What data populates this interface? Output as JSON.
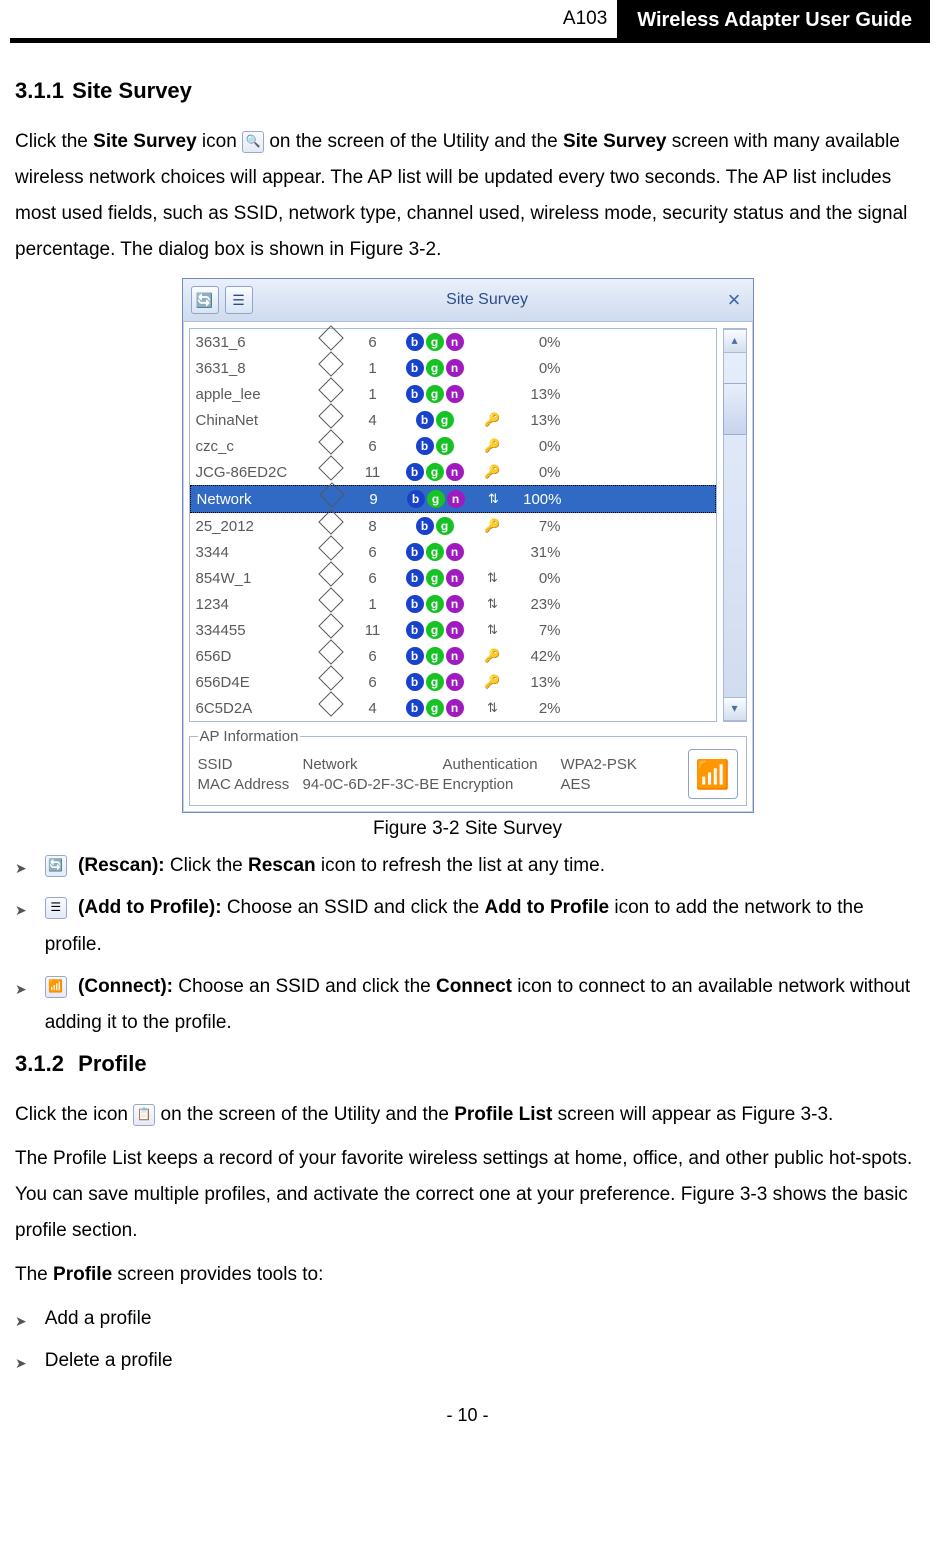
{
  "header": {
    "model": "A103",
    "title": "Wireless Adapter User Guide"
  },
  "section_311": {
    "number": "3.1.1",
    "title": "Site Survey",
    "para1_pre": "Click the ",
    "para1_bold1": "Site Survey",
    "para1_mid": " icon ",
    "para1_after_icon": " on the screen of the Utility and the ",
    "para1_bold2": "Site Survey",
    "para1_end": " screen with many available wireless network choices will appear. The AP list will be updated every two seconds. The AP list includes most used fields, such as SSID, network type, channel used, wireless mode, security status and the signal percentage. The dialog box is shown in Figure 3-2."
  },
  "survey": {
    "title": "Site Survey",
    "rows": [
      {
        "ssid": "3631_6",
        "ch": "6",
        "b": true,
        "g": true,
        "n": true,
        "sec": "",
        "sig": "0%"
      },
      {
        "ssid": "3631_8",
        "ch": "1",
        "b": true,
        "g": true,
        "n": true,
        "sec": "",
        "sig": "0%"
      },
      {
        "ssid": "apple_lee",
        "ch": "1",
        "b": true,
        "g": true,
        "n": true,
        "sec": "",
        "sig": "13%"
      },
      {
        "ssid": "ChinaNet",
        "ch": "4",
        "b": true,
        "g": true,
        "n": false,
        "sec": "🔑",
        "sig": "13%"
      },
      {
        "ssid": "czc_c",
        "ch": "6",
        "b": true,
        "g": true,
        "n": false,
        "sec": "🔑",
        "sig": "0%"
      },
      {
        "ssid": "JCG-86ED2C",
        "ch": "11",
        "b": true,
        "g": true,
        "n": true,
        "sec": "🔑",
        "sig": "0%"
      },
      {
        "ssid": "Network",
        "ch": "9",
        "b": true,
        "g": true,
        "n": true,
        "sec": "⇅",
        "sig": "100%",
        "selected": true
      },
      {
        "ssid": "25_2012",
        "ch": "8",
        "b": true,
        "g": true,
        "n": false,
        "sec": "🔑",
        "sig": "7%"
      },
      {
        "ssid": "3344",
        "ch": "6",
        "b": true,
        "g": true,
        "n": true,
        "sec": "",
        "sig": "31%"
      },
      {
        "ssid": "854W_1",
        "ch": "6",
        "b": true,
        "g": true,
        "n": true,
        "sec": "⇅",
        "sig": "0%"
      },
      {
        "ssid": "1234",
        "ch": "1",
        "b": true,
        "g": true,
        "n": true,
        "sec": "⇅",
        "sig": "23%"
      },
      {
        "ssid": "334455",
        "ch": "11",
        "b": true,
        "g": true,
        "n": true,
        "sec": "⇅",
        "sig": "7%"
      },
      {
        "ssid": "656D",
        "ch": "6",
        "b": true,
        "g": true,
        "n": true,
        "sec": "🔑",
        "sig": "42%"
      },
      {
        "ssid": "656D4E",
        "ch": "6",
        "b": true,
        "g": true,
        "n": true,
        "sec": "🔑",
        "sig": "13%"
      },
      {
        "ssid": "6C5D2A",
        "ch": "4",
        "b": true,
        "g": true,
        "n": true,
        "sec": "⇅",
        "sig": "2%"
      }
    ],
    "ap_info_title": "AP Information",
    "ssid_label": "SSID",
    "ssid_value": "Network",
    "auth_label": "Authentication",
    "auth_value": "WPA2-PSK",
    "mac_label": "MAC Address",
    "mac_value": "94-0C-6D-2F-3C-BE",
    "enc_label": "Encryption",
    "enc_value": "AES"
  },
  "figure_caption": "Figure 3-2 Site Survey",
  "bullets1": {
    "b1_bold": "(Rescan):",
    "b1_text1": " Click the ",
    "b1_bold2": "Rescan",
    "b1_text2": " icon to refresh the list at any time.",
    "b2_bold": "(Add to Profile):",
    "b2_text1": " Choose an SSID and click the ",
    "b2_bold2": "Add to Profile",
    "b2_text2": " icon to add the network to the profile.",
    "b3_bold": "(Connect):",
    "b3_text1": " Choose an SSID and click the ",
    "b3_bold2": "Connect",
    "b3_text2": " icon to connect to an available network without adding it to the profile."
  },
  "section_312": {
    "number": "3.1.2",
    "title": "Profile",
    "para1_pre": "Click the icon ",
    "para1_mid": " on the screen of the Utility and the ",
    "para1_bold": "Profile List",
    "para1_end": " screen will appear as Figure 3-3.",
    "para2": "The Profile List keeps a record of your favorite wireless settings at home, office, and other public hot-spots. You can save multiple profiles, and activate the correct one at your preference. Figure 3-3 shows the basic profile section.",
    "para3_pre": "The ",
    "para3_bold": "Profile",
    "para3_end": " screen provides tools to:",
    "bullets": [
      "Add a profile",
      "Delete a profile"
    ]
  },
  "page_number": "- 10 -"
}
